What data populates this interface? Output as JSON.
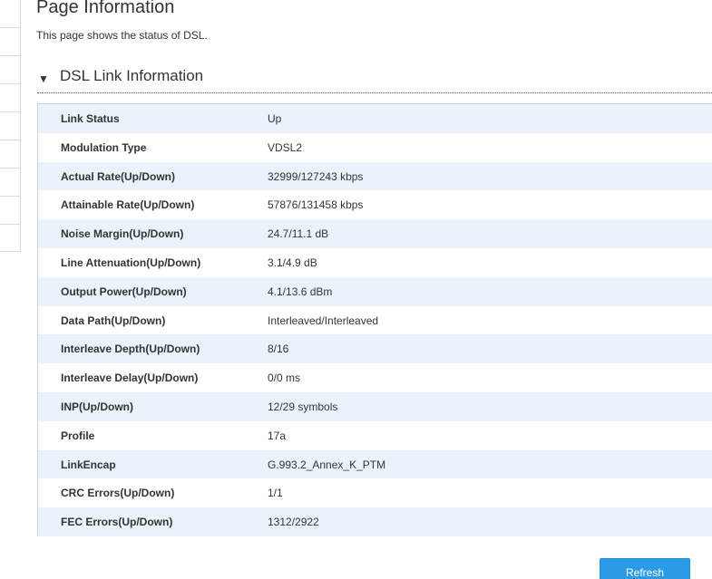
{
  "page": {
    "title": "Page Information",
    "description": "This page shows the status of DSL."
  },
  "section": {
    "title": "DSL Link Information",
    "expanded_icon": "triangle-down"
  },
  "rows": [
    {
      "label": "Link Status",
      "value": "Up"
    },
    {
      "label": "Modulation Type",
      "value": "VDSL2"
    },
    {
      "label": "Actual Rate(Up/Down)",
      "value": "32999/127243 kbps"
    },
    {
      "label": "Attainable Rate(Up/Down)",
      "value": "57876/131458 kbps"
    },
    {
      "label": "Noise Margin(Up/Down)",
      "value": "24.7/11.1 dB"
    },
    {
      "label": "Line Attenuation(Up/Down)",
      "value": "3.1/4.9 dB"
    },
    {
      "label": "Output Power(Up/Down)",
      "value": "4.1/13.6 dBm"
    },
    {
      "label": "Data Path(Up/Down)",
      "value": "Interleaved/Interleaved"
    },
    {
      "label": "Interleave Depth(Up/Down)",
      "value": "8/16"
    },
    {
      "label": "Interleave Delay(Up/Down)",
      "value": "0/0 ms"
    },
    {
      "label": "INP(Up/Down)",
      "value": "12/29 symbols"
    },
    {
      "label": "Profile",
      "value": "17a"
    },
    {
      "label": "LinkEncap",
      "value": "G.993.2_Annex_K_PTM"
    },
    {
      "label": "CRC Errors(Up/Down)",
      "value": "1/1"
    },
    {
      "label": "FEC Errors(Up/Down)",
      "value": "1312/2922"
    }
  ],
  "actions": {
    "refresh_label": "Refresh"
  },
  "colors": {
    "row_shade": "#eaf3fb",
    "button": "#2b9be8",
    "border": "#c9d3de"
  }
}
